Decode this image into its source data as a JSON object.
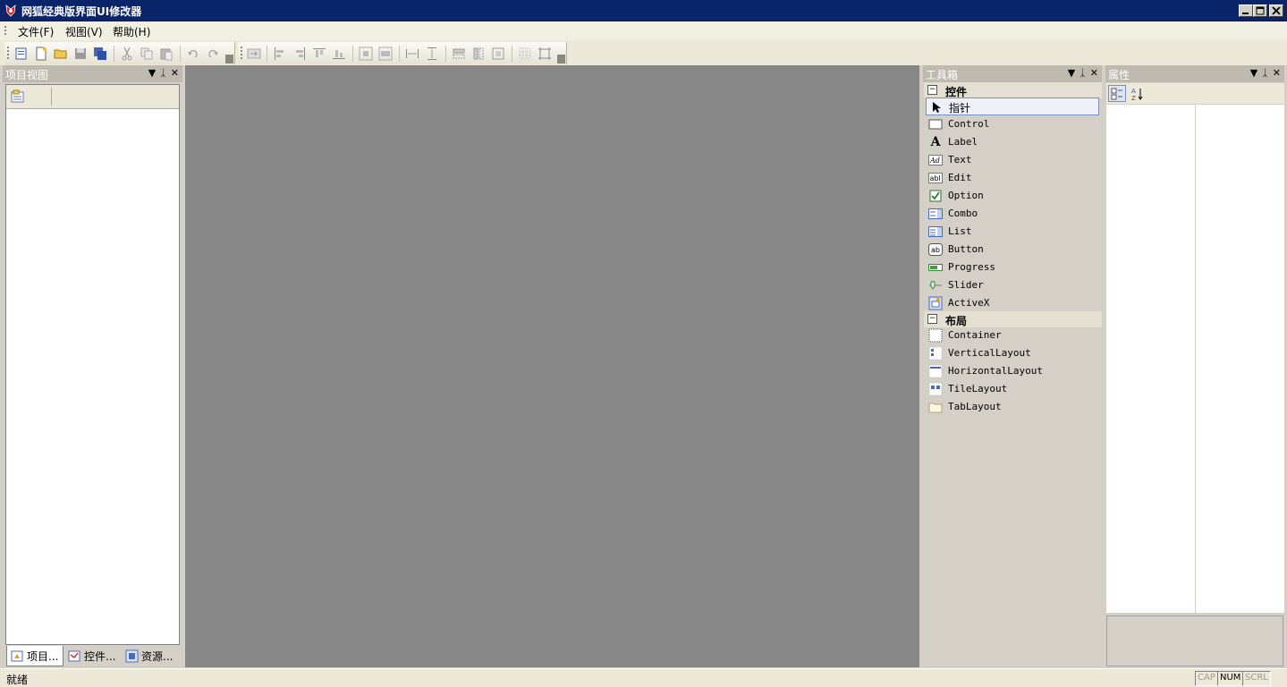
{
  "window": {
    "title": "网狐经典版界面UI修改器"
  },
  "menu": {
    "items": [
      "文件(F)",
      "视图(V)",
      "帮助(H)"
    ]
  },
  "panels": {
    "project": {
      "title": "项目视图"
    },
    "toolbox": {
      "title": "工具箱"
    },
    "properties": {
      "title": "属性"
    }
  },
  "bottom_tabs": [
    "项目...",
    "控件...",
    "资源..."
  ],
  "toolbox": {
    "categories": [
      {
        "label": "控件",
        "items": [
          "指针",
          "Control",
          "Label",
          "Text",
          "Edit",
          "Option",
          "Combo",
          "List",
          "Button",
          "Progress",
          "Slider",
          "ActiveX"
        ]
      },
      {
        "label": "布局",
        "items": [
          "Container",
          "VerticalLayout",
          "HorizontalLayout",
          "TileLayout",
          "TabLayout"
        ]
      }
    ],
    "selected": "指针"
  },
  "status": {
    "text": "就绪",
    "indicators": [
      "CAP",
      "NUM",
      "SCRL"
    ],
    "active_indicator": "NUM"
  },
  "colors": {
    "titlebar": "#0a246a",
    "workspace": "#878787",
    "panel_header": "#bfbab0"
  }
}
